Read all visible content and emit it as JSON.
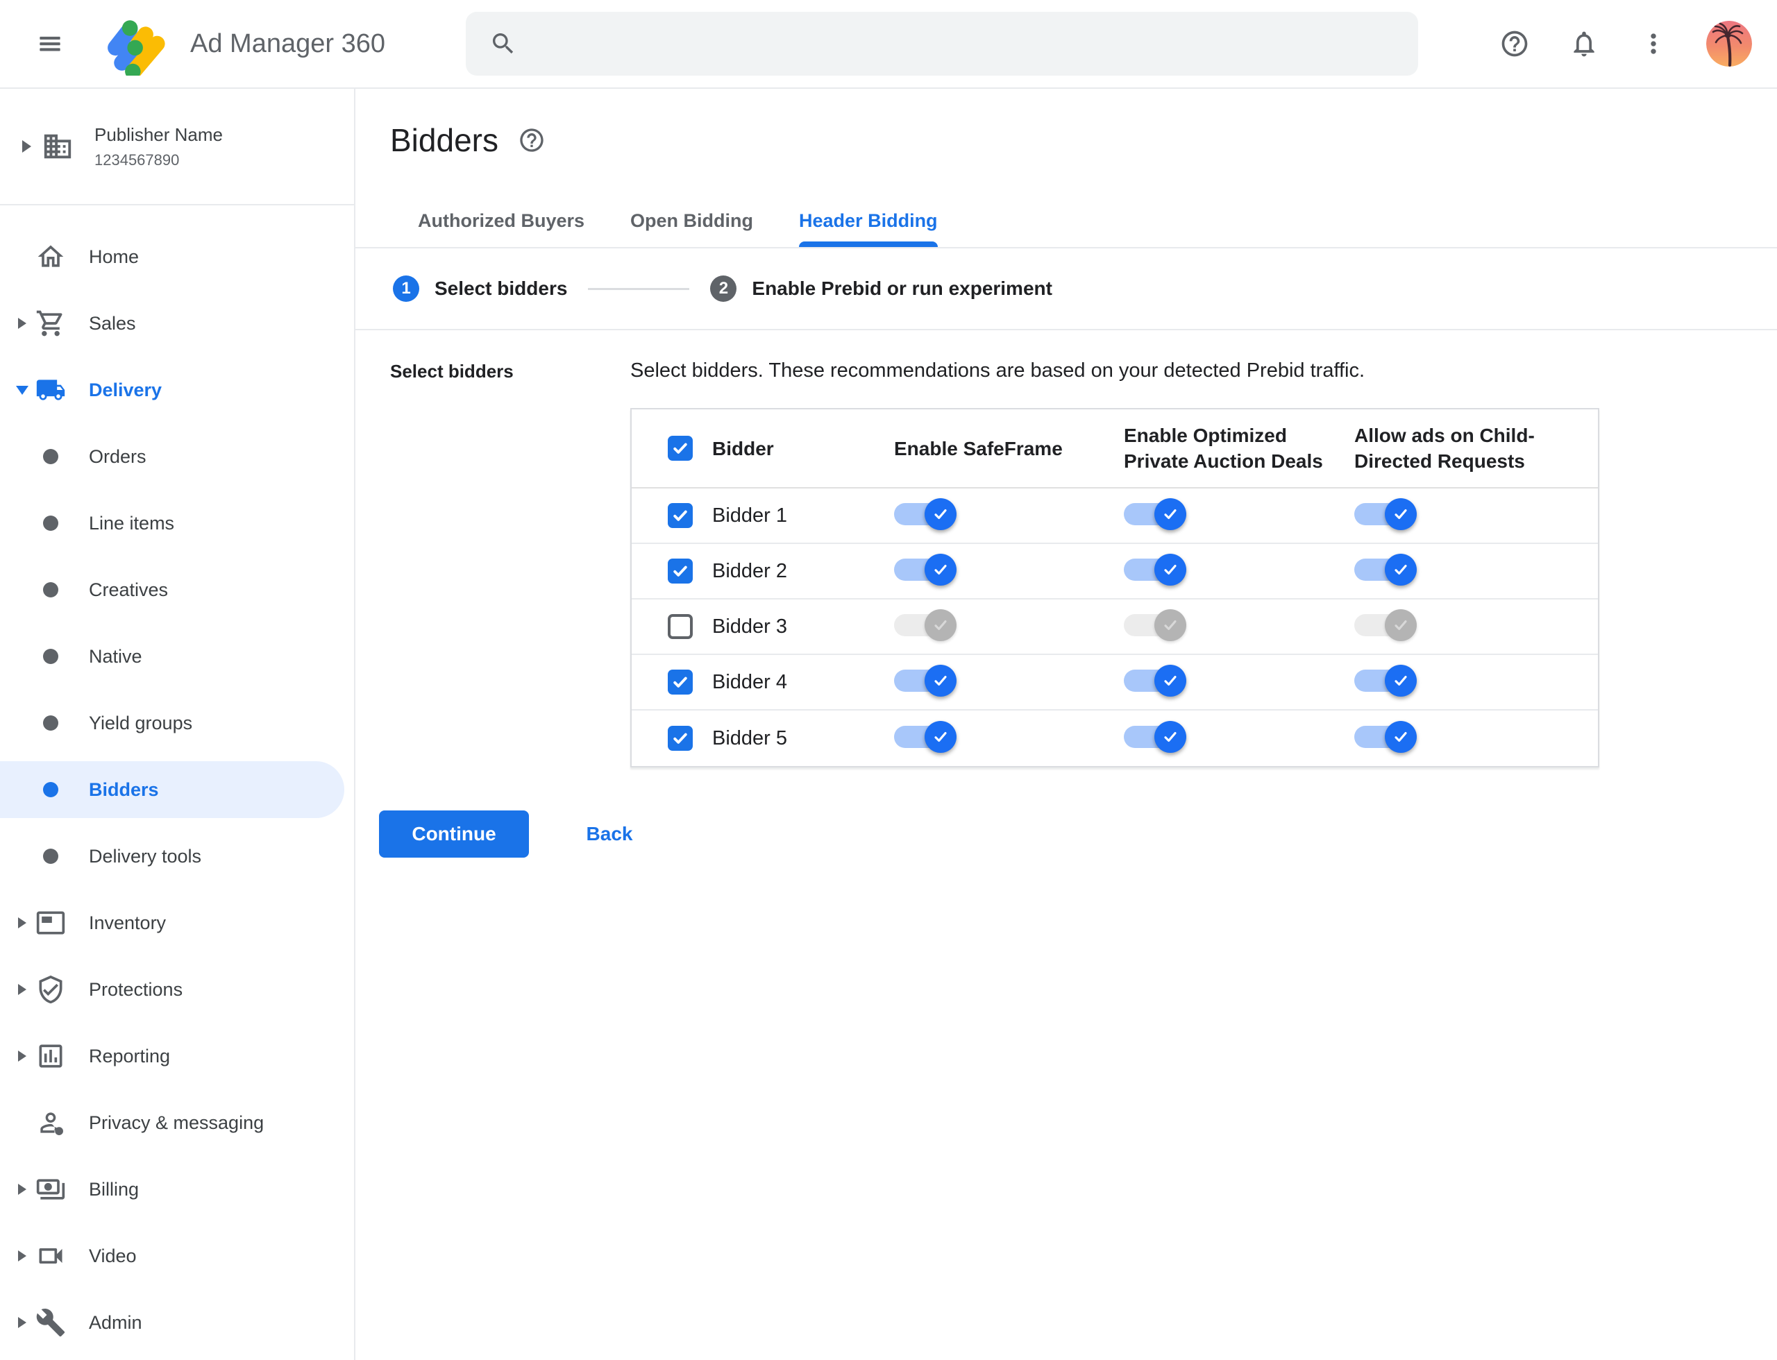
{
  "topbar": {
    "app_title": "Ad Manager 360",
    "search_placeholder": ""
  },
  "sidebar": {
    "publisher": {
      "name": "Publisher Name",
      "id": "1234567890"
    },
    "items": [
      {
        "label": "Home"
      },
      {
        "label": "Sales",
        "collapsed": true
      },
      {
        "label": "Delivery",
        "expanded": true
      },
      {
        "label": "Orders",
        "sub": true
      },
      {
        "label": "Line items",
        "sub": true
      },
      {
        "label": "Creatives",
        "sub": true
      },
      {
        "label": "Native",
        "sub": true
      },
      {
        "label": "Yield groups",
        "sub": true
      },
      {
        "label": "Bidders",
        "sub": true,
        "selected": true
      },
      {
        "label": "Delivery tools",
        "sub": true
      },
      {
        "label": "Inventory",
        "collapsed": true
      },
      {
        "label": "Protections",
        "collapsed": true
      },
      {
        "label": "Reporting",
        "collapsed": true
      },
      {
        "label": "Privacy & messaging"
      },
      {
        "label": "Billing",
        "collapsed": true
      },
      {
        "label": "Video",
        "collapsed": true
      },
      {
        "label": "Admin",
        "collapsed": true
      }
    ]
  },
  "page": {
    "title": "Bidders",
    "tabs": [
      {
        "label": "Authorized Buyers",
        "active": false
      },
      {
        "label": "Open Bidding",
        "active": false
      },
      {
        "label": "Header Bidding",
        "active": true
      }
    ],
    "steps": [
      {
        "number": "1",
        "label": "Select bidders",
        "state": "active"
      },
      {
        "number": "2",
        "label": "Enable Prebid or run experiment",
        "state": "upcoming"
      }
    ],
    "section_label": "Select bidders",
    "description": "Select bidders. These recommendations are based on your detected Prebid traffic.",
    "table": {
      "header_select_all": true,
      "columns": [
        "Bidder",
        "Enable SafeFrame",
        "Enable Optimized Private Auction Deals",
        "Allow ads on Child-Directed Requests"
      ],
      "rows": [
        {
          "name": "Bidder 1",
          "checked": true,
          "toggles": [
            true,
            true,
            true
          ]
        },
        {
          "name": "Bidder 2",
          "checked": true,
          "toggles": [
            true,
            true,
            true
          ]
        },
        {
          "name": "Bidder 3",
          "checked": false,
          "toggles": [
            false,
            false,
            false
          ]
        },
        {
          "name": "Bidder 4",
          "checked": true,
          "toggles": [
            true,
            true,
            true
          ]
        },
        {
          "name": "Bidder 5",
          "checked": true,
          "toggles": [
            true,
            true,
            true
          ]
        }
      ]
    },
    "actions": {
      "continue_label": "Continue",
      "back_label": "Back"
    }
  },
  "colors": {
    "accent": "#1a73e8",
    "selected_item_bg": "#e8f0fe",
    "toggle_on_track": "#a8c7fa",
    "toggle_off_track": "#ececec",
    "toggle_off_thumb": "#b4b4b4",
    "border": "#dadce0",
    "text_gray": "#5f6368"
  }
}
